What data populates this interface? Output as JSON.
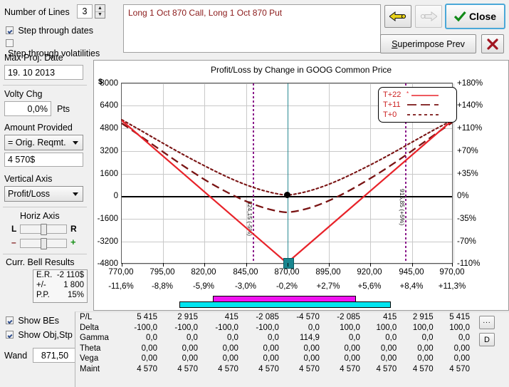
{
  "sidebar": {
    "number_of_lines_label": "Number of Lines",
    "number_of_lines_value": "3",
    "step_dates_label": "Step through dates",
    "step_vols_label": "Step through volatilities",
    "max_proj_date_label": "Max Proj. Date",
    "max_proj_date_value": "19. 10 2013",
    "volty_chg_label": "Volty Chg",
    "volty_chg_value": "0,0%",
    "pts_label": "Pts",
    "amount_provided_label": "Amount Provided",
    "amount_provided_value": "= Orig. Reqmt.",
    "amount_value": "4 570$",
    "vertical_axis_label": "Vertical Axis",
    "vertical_axis_value": "Profit/Loss",
    "horiz_axis_label": "Horiz Axis",
    "horiz_left": "L",
    "horiz_right": "R",
    "zoom_minus": "–",
    "zoom_plus": "+",
    "curr_bell_label": "Curr. Bell Results",
    "bell_rows": [
      {
        "name": "E.R.",
        "value": "-2 110$"
      },
      {
        "name": "+/-",
        "value": "1 800"
      },
      {
        "name": "P.P.",
        "value": "15%"
      }
    ],
    "show_bes_label": "Show BEs",
    "show_objstp_label": "Show Obj,Stp",
    "wand_label": "Wand",
    "wand_value": "871,50"
  },
  "header": {
    "position_text": "Long 1 Oct 870 Call, Long 1 Oct 870 Put",
    "back_button": "",
    "forward_button": "",
    "close_button": "Close",
    "superimpose_button": "Superimpose Prev",
    "cancel_button": "✖"
  },
  "chart_data": {
    "type": "line",
    "title": "Profit/Loss by Change in GOOG Common Price",
    "ylabel": "$",
    "xlabel": "",
    "ylim": [
      -4800,
      8000
    ],
    "yticks": [
      "8000",
      "6400",
      "4800",
      "3200",
      "1600",
      "0",
      "-1600",
      "-3200",
      "-4800"
    ],
    "ytick_values": [
      8000,
      6400,
      4800,
      3200,
      1600,
      0,
      -1600,
      -3200,
      -4800
    ],
    "yticks_right": [
      "+180%",
      "+140%",
      "+110%",
      "+70%",
      "+35%",
      "0%",
      "-35%",
      "-70%",
      "-110%"
    ],
    "x": [
      770,
      795,
      820,
      845,
      870,
      895,
      920,
      945,
      970
    ],
    "xticks": [
      "770,00",
      "795,00",
      "820,00",
      "845,00",
      "870,00",
      "895,00",
      "920,00",
      "945,00",
      "970,00"
    ],
    "xticks_pct": [
      "-11,6%",
      "-8,8%",
      "-5,9%",
      "-3,0%",
      "-0,2%",
      "+2,7%",
      "+5,6%",
      "+8,4%",
      "+11,3%"
    ],
    "grid": true,
    "legend_position": "top-right",
    "series": [
      {
        "name": "T+22",
        "color": "#e8232a",
        "style": "solid",
        "values": [
          5415,
          2915,
          415,
          -2085,
          -4570,
          -2085,
          415,
          2915,
          5415
        ]
      },
      {
        "name": "T+11",
        "color": "#7a1414",
        "style": "dashed",
        "values": [
          5050,
          2650,
          400,
          -1200,
          -1700,
          -1250,
          300,
          2450,
          4900
        ]
      },
      {
        "name": "T+0",
        "color": "#7a1414",
        "style": "dotted",
        "values": [
          5250,
          3050,
          1200,
          -50,
          -480,
          -60,
          1150,
          3000,
          5200
        ]
      }
    ],
    "breakeven_lines": [
      {
        "label": "824,15 (-5%)",
        "x": 824.15,
        "color": "#8b1a8b"
      },
      {
        "label": "915,85 (+5%)",
        "x": 915.85,
        "color": "#8b1a8b"
      }
    ],
    "current_price_line": {
      "x": 870,
      "color": "#2a8a93"
    },
    "current_marker_value": -4570,
    "expected_marker_value": -480,
    "range_bars": [
      {
        "name": "std-dev-band",
        "color": "#00e5f0",
        "from": 792,
        "to": 948
      },
      {
        "name": "objective-band",
        "color": "#f013f0",
        "from": 827,
        "to": 905
      }
    ]
  },
  "table": {
    "row_labels": [
      "P/L",
      "Delta",
      "Gamma",
      "Theta",
      "Vega",
      "Maint"
    ],
    "rows": [
      {
        "label": "P/L",
        "values": [
          "5 415",
          "2 915",
          "415",
          "-2 085",
          "-4 570",
          "-2 085",
          "415",
          "2 915",
          "5 415"
        ]
      },
      {
        "label": "Delta",
        "values": [
          "-100,0",
          "-100,0",
          "-100,0",
          "-100,0",
          "0,0",
          "100,0",
          "100,0",
          "100,0",
          "100,0"
        ]
      },
      {
        "label": "Gamma",
        "values": [
          "0,0",
          "0,0",
          "0,0",
          "0,0",
          "114,9",
          "0,0",
          "0,0",
          "0,0",
          "0,0"
        ]
      },
      {
        "label": "Theta",
        "values": [
          "0,00",
          "0,00",
          "0,00",
          "0,00",
          "0,00",
          "0,00",
          "0,00",
          "0,00",
          "0,00"
        ]
      },
      {
        "label": "Vega",
        "values": [
          "0,00",
          "0,00",
          "0,00",
          "0,00",
          "0,00",
          "0,00",
          "0,00",
          "0,00",
          "0,00"
        ]
      },
      {
        "label": "Maint",
        "values": [
          "4 570",
          "4 570",
          "4 570",
          "4 570",
          "4 570",
          "4 570",
          "4 570",
          "4 570",
          "4 570"
        ]
      }
    ],
    "ellipsis_button": "...",
    "detail_button": "D"
  }
}
